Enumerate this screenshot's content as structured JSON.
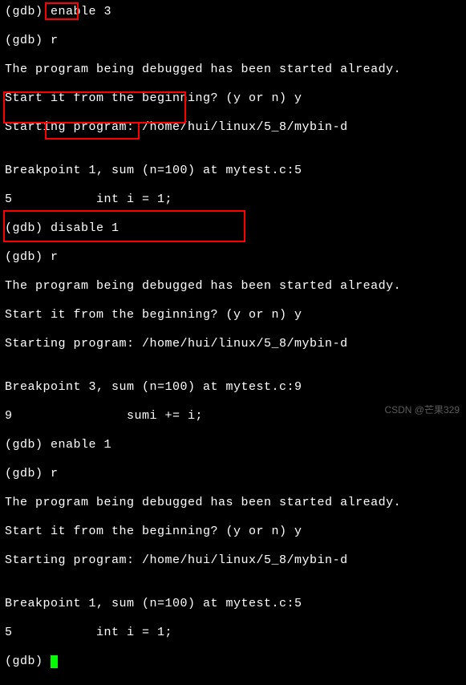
{
  "lines": {
    "l0": "(gdb) enable 3",
    "l1_prompt": "(gdb) ",
    "l1_cmd": "r",
    "l2": "The program being debugged has been started already.",
    "l3": "Start it from the beginning? (y or n) y",
    "l4": "Starting program: /home/hui/linux/5_8/mybin-d",
    "l5": "",
    "l6": "Breakpoint 1, sum (n=100) at mytest.c:5",
    "l7_num": "5",
    "l7_code": "           int i = 1;",
    "l8_prompt": "(gdb) ",
    "l8_cmd": "disable 1",
    "l9": "(gdb) r",
    "l10": "The program being debugged has been started already.",
    "l11": "Start it from the beginning? (y or n) y",
    "l12": "Starting program: /home/hui/linux/5_8/mybin-d",
    "l13": "",
    "l14": "Breakpoint 3, sum (n=100) at mytest.c:9",
    "l15_num": "9",
    "l15_code": "               sumi += i;",
    "l16": "(gdb) enable 1",
    "l17": "(gdb) r",
    "l18": "The program being debugged has been started already.",
    "l19": "Start it from the beginning? (y or n) y",
    "l20": "Starting program: /home/hui/linux/5_8/mybin-d",
    "l21": "",
    "l22": "Breakpoint 1, sum (n=100) at mytest.c:5",
    "l23": "5           int i = 1;",
    "l24_prompt": "(gdb) "
  },
  "watermark": "CSDN @芒果329"
}
